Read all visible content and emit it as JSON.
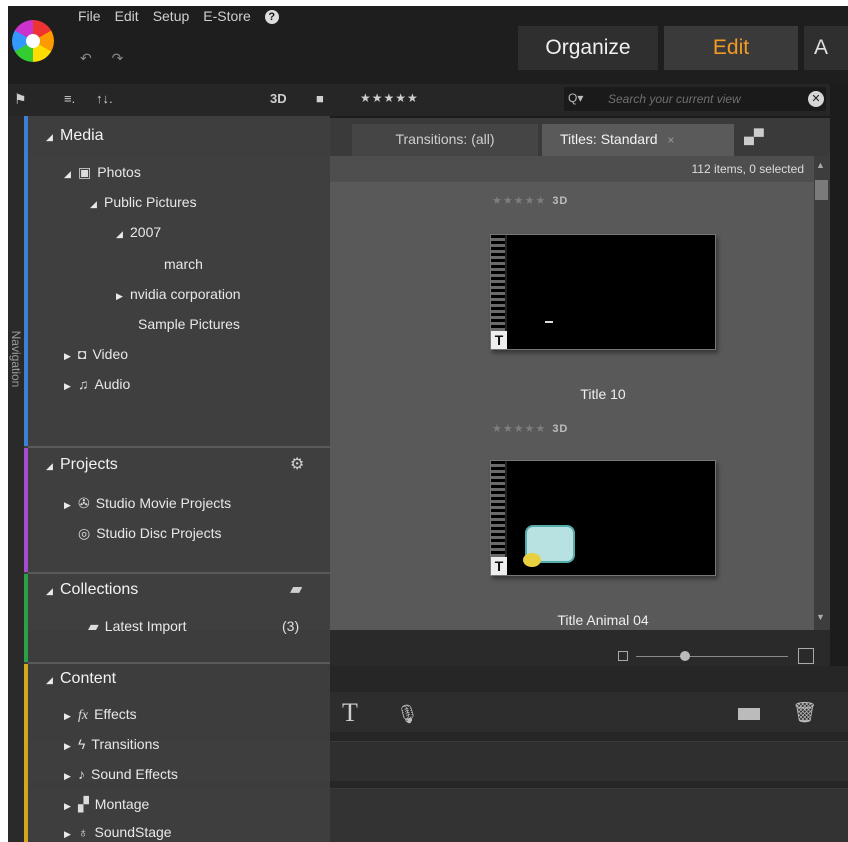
{
  "menu": {
    "file": "File",
    "edit": "Edit",
    "setup": "Setup",
    "estore": "E-Store",
    "help_icon": "?"
  },
  "undo_redo": "↶ ↷",
  "mode_tabs": {
    "organize": "Organize",
    "edit": "Edit",
    "third": "A"
  },
  "toolbar": {
    "view_icon": "≡.",
    "sort_icon": "↑↓.",
    "three_d": "3D",
    "stars": "★★★★★",
    "search_icon": "Q▾",
    "search_placeholder": "Search your current view"
  },
  "library_tabs": {
    "transitions": "Transitions: (all)",
    "titles": "Titles: Standard",
    "titles_close": "×"
  },
  "browser": {
    "item_count": "112 items, 0 selected",
    "clips": [
      {
        "rating": "★★★★★",
        "badge": "3D",
        "title": "Title 10"
      },
      {
        "rating": "★★★★★",
        "badge": "3D",
        "title": "Title Animal 04"
      }
    ]
  },
  "navigation": {
    "label": "Navigation",
    "media": {
      "header": "Media",
      "photos": "Photos",
      "public_pictures": "Public Pictures",
      "year": "2007",
      "march": "march",
      "nvidia": "nvidia corporation",
      "sample": "Sample Pictures",
      "video": "Video",
      "audio": "Audio"
    },
    "projects": {
      "header": "Projects",
      "movie": "Studio Movie Projects",
      "disc": "Studio Disc Projects"
    },
    "collections": {
      "header": "Collections",
      "latest": "Latest Import",
      "latest_count": "(3)"
    },
    "content": {
      "header": "Content",
      "effects": "Effects",
      "transitions": "Transitions",
      "sound_effects": "Sound Effects",
      "montage": "Montage",
      "soundstage": "SoundStage"
    }
  },
  "colors": {
    "accent_edit": "#f39a24",
    "media_bar": "#3f7ed6",
    "projects_bar": "#a44bd0",
    "collections_bar": "#2ca046",
    "content_bar": "#d4a81e"
  }
}
